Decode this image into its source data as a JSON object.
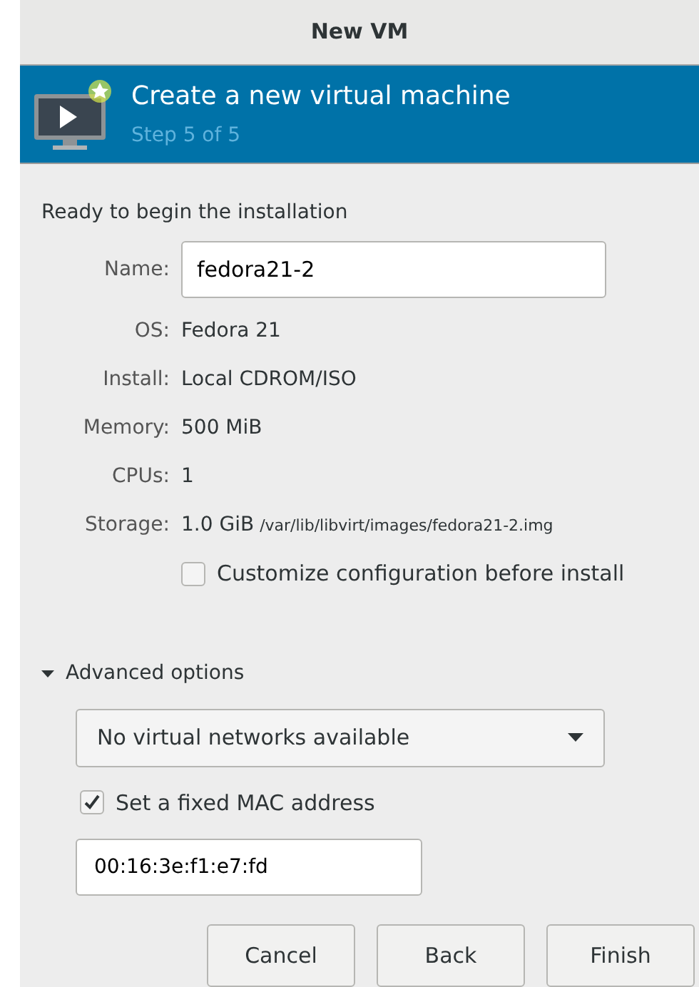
{
  "window": {
    "title": "New VM"
  },
  "header": {
    "title": "Create a new virtual machine",
    "step": "Step 5 of 5"
  },
  "heading": "Ready to begin the installation",
  "name_field": {
    "label": "Name:",
    "value": "fedora21-2"
  },
  "details": [
    {
      "label": "OS:",
      "value": "Fedora 21"
    },
    {
      "label": "Install:",
      "value": "Local CDROM/ISO"
    },
    {
      "label": "Memory:",
      "value": "500 MiB"
    },
    {
      "label": "CPUs:",
      "value": "1"
    },
    {
      "label": "Storage:",
      "value": "1.0 GiB",
      "note": "/var/lib/libvirt/images/fedora21-2.img"
    }
  ],
  "customize": {
    "label": "Customize configuration before install",
    "checked": false
  },
  "advanced": {
    "label": "Advanced options",
    "expanded": true,
    "network": {
      "value": "No virtual networks available"
    },
    "fixed_mac": {
      "label": "Set a fixed MAC address",
      "checked": true
    },
    "mac_field": {
      "value": "00:16:3e:f1:e7:fd"
    }
  },
  "buttons": [
    "Cancel",
    "Back",
    "Finish"
  ]
}
